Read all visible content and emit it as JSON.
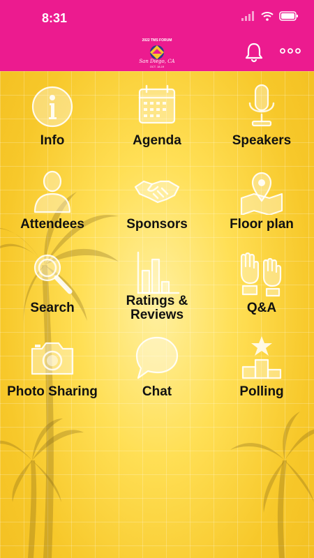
{
  "status_bar": {
    "time": "8:31"
  },
  "header": {
    "logo_top_text": "2022 TMS FORUM",
    "logo_script": "San Diego, CA",
    "logo_dates": "OCT. 18-19",
    "colors": {
      "header_bg": "#ec1b8f",
      "background": "#ffd93f"
    }
  },
  "tiles": [
    {
      "label": "Info",
      "icon": "info-icon"
    },
    {
      "label": "Agenda",
      "icon": "calendar-icon"
    },
    {
      "label": "Speakers",
      "icon": "microphone-icon"
    },
    {
      "label": "Attendees",
      "icon": "person-icon"
    },
    {
      "label": "Sponsors",
      "icon": "handshake-icon"
    },
    {
      "label": "Floor plan",
      "icon": "map-pin-icon"
    },
    {
      "label": "Search",
      "icon": "magnifier-icon"
    },
    {
      "label": "Ratings & Reviews",
      "icon": "bar-chart-icon"
    },
    {
      "label": "Q&A",
      "icon": "raised-hands-icon"
    },
    {
      "label": "Photo Sharing",
      "icon": "camera-icon"
    },
    {
      "label": "Chat",
      "icon": "chat-bubble-icon"
    },
    {
      "label": "Polling",
      "icon": "podium-icon"
    }
  ]
}
